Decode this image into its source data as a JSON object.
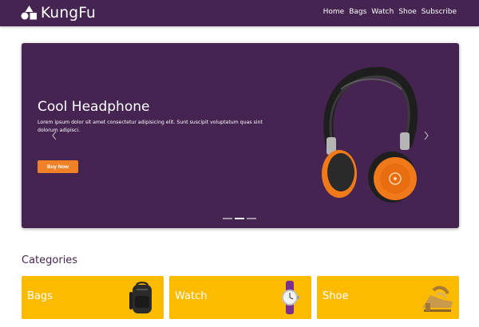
{
  "brand": {
    "name": "KungFu",
    "logo_icon": "shapes-logo-icon"
  },
  "nav": {
    "links": [
      {
        "label": "Home"
      },
      {
        "label": "Bags"
      },
      {
        "label": "Watch"
      },
      {
        "label": "Shoe"
      },
      {
        "label": "Subscribe"
      }
    ]
  },
  "hero": {
    "title": "Cool Headphone",
    "text": "Lorem ipsum dolor sit amet consectetur adipisicing elit. Sunt suscipit voluptatum quas sint dolorum adipisci.",
    "button_label": "Buy Now",
    "slide_count": 3,
    "active_slide": 2
  },
  "categories": {
    "title": "Categories",
    "items": [
      {
        "label": "Bags",
        "icon": "backpack-image"
      },
      {
        "label": "Watch",
        "icon": "wristwatch-image"
      },
      {
        "label": "Shoe",
        "icon": "sandal-image"
      }
    ]
  },
  "colors": {
    "primary": "#452451",
    "accent": "#f08127",
    "card": "#fdbb00",
    "text_light": "#ffffff"
  }
}
